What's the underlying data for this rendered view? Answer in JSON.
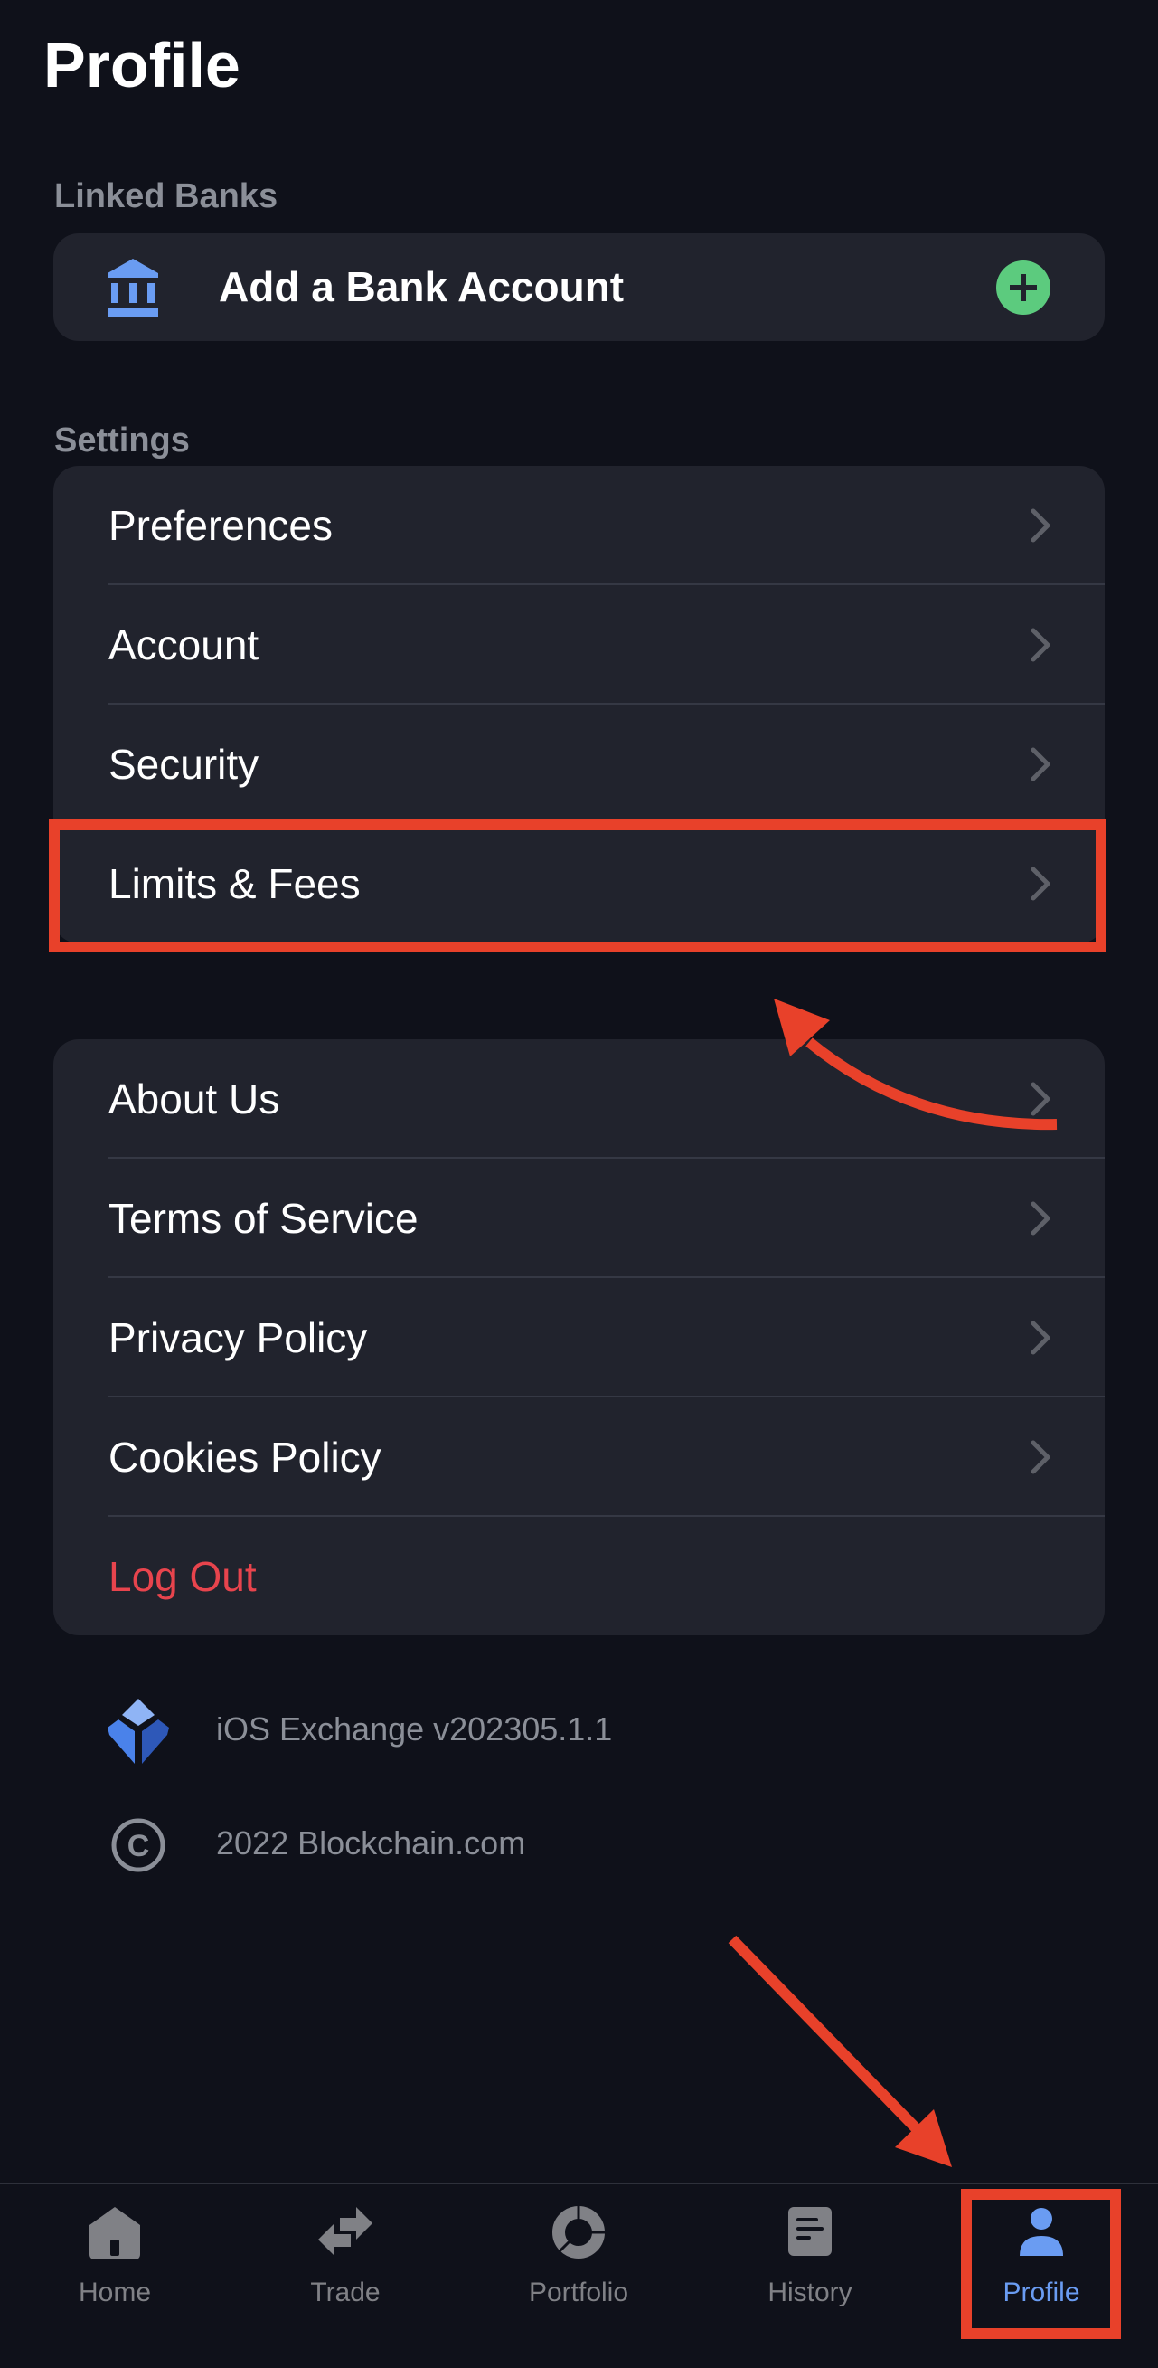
{
  "header": {
    "title": "Profile"
  },
  "linked_banks": {
    "section_label": "Linked Banks",
    "add_bank": {
      "label": "Add a Bank Account",
      "icon": "bank-icon",
      "action_icon": "plus-circle-icon"
    }
  },
  "settings": {
    "section_label": "Settings",
    "items": [
      {
        "label": "Preferences",
        "icon": "chevron-right-icon"
      },
      {
        "label": "Account",
        "icon": "chevron-right-icon"
      },
      {
        "label": "Security",
        "icon": "chevron-right-icon"
      },
      {
        "label": "Limits & Fees",
        "icon": "chevron-right-icon",
        "highlighted": true
      }
    ]
  },
  "legal": {
    "items": [
      {
        "label": "About Us",
        "icon": "chevron-right-icon"
      },
      {
        "label": "Terms of Service",
        "icon": "chevron-right-icon"
      },
      {
        "label": "Privacy Policy",
        "icon": "chevron-right-icon"
      },
      {
        "label": "Cookies Policy",
        "icon": "chevron-right-icon"
      },
      {
        "label": "Log Out",
        "destructive": true
      }
    ]
  },
  "footer": {
    "version": {
      "icon": "blockchain-logo-icon",
      "text": "iOS Exchange v202305.1.1"
    },
    "copyright": {
      "icon": "copyright-icon",
      "text": "2022 Blockchain.com"
    }
  },
  "tabbar": {
    "active": "Profile",
    "tabs": [
      {
        "label": "Home",
        "icon": "home-icon"
      },
      {
        "label": "Trade",
        "icon": "trade-arrows-icon"
      },
      {
        "label": "Portfolio",
        "icon": "portfolio-donut-icon"
      },
      {
        "label": "History",
        "icon": "history-doc-icon"
      },
      {
        "label": "Profile",
        "icon": "user-icon"
      }
    ]
  },
  "colors": {
    "background": "#0F111A",
    "card": "#21232D",
    "accent": "#6A9CF2",
    "success": "#5CCB7E",
    "danger": "#E8444D",
    "annotation": "#E8412A",
    "muted": "#8B8F98"
  }
}
